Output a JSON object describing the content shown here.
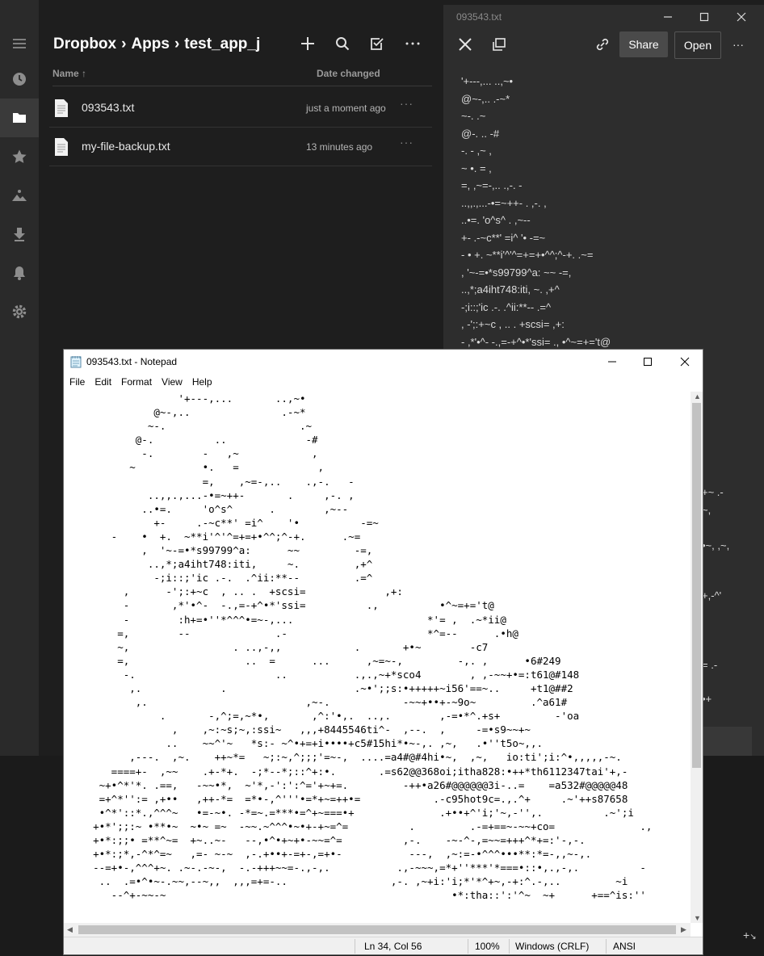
{
  "dropbox": {
    "breadcrumb": [
      "Dropbox",
      "Apps",
      "test_app_j"
    ],
    "breadcrumb_sep": "›",
    "columns": {
      "name": "Name ↑",
      "date": "Date changed"
    },
    "files": [
      {
        "name": "093543.txt",
        "date": "just a moment ago",
        "more": "···"
      },
      {
        "name": "my-file-backup.txt",
        "date": "13 minutes ago",
        "more": "···"
      }
    ]
  },
  "preview": {
    "title": "093543.txt",
    "share_label": "Share",
    "open_label": "Open",
    "more_label": "···",
    "text": "'+---,... ..,~•\n@~-,.. .-~*\n~-. .~\n@-. .. -#\n-. - ,~ ,\n~ •. = ,\n=, ,~=-,.. .,-. -\n..,,.,...-•=~++- . ,-. ,\n..•=. 'o^s^ . ,~--\n+- .-~c**' =i^ '• -=~\n- • +. ~**i'^'^=+=+•^^;^-+. .~=\n, '~-=•*s99799^a: ~~ -=,\n..,*;a4iht748:iti, ~. ,+^\n-;i::;'ic .-. .^ii:**-- .=^\n, -';:+~c , .. . +scsi= ,+:\n- ,*'•^- -.,=-+^•*'ssi= ., •^~=+='t@",
    "peek": [
      "+~ .-",
      "~,",
      "•~, ,~,",
      "+,-^'",
      "= .-",
      "•+"
    ]
  },
  "notepad": {
    "title": "093543.txt - Notepad",
    "menu": [
      "File",
      "Edit",
      "Format",
      "View",
      "Help"
    ],
    "text": "                  '+---,...       ..,~•\n              @~-,..               .-~*\n             ~-.                      .~\n           @-.          ..             -#\n            -.        -   ,~            ,\n          ~           •.   =             ,\n                      =,    ,~=-,..    .,-.   -\n             ..,,.,...-•=~++-       .     ,-. ,\n            ..•=.     'o^s^      .        ,~--\n              +-     .-~c**' =i^    '•          -=~\n       -    •  +.  ~**i'^'^=+=+•^^;^-+.      .~=\n            ,  '~-=•*s99799^a:      ~~         -=,\n             ..,*;a4iht748:iti,     ~.         ,+^\n              -;i::;'ic .-.  .^ii:**--         .=^\n         ,      -';:+~c  , .. .  +scsi=             ,+:\n         -       ,*'•^-  -.,=-+^•*'ssi=          .,          •^~=+='t@\n         -        :h+=•''*^^^•=~-,...                      *'= ,  .~*ii@\n        =,        --              .-                       *^=--      .•h@\n        ~,                 . ..,-,,            .       +•~        -c7\n        =,                   ..  =      ...      ,~=~-,         -,. ,      •6#249\n         -.                       ..           .,.,~+*sco4        , ,-~~+•=:t61@#148\n          ,.             .                     .~•';;s:•+++++~i56'==~..     +t1@##2\n           ,.                          ,~-.            -~~+••+-~9o~         .^a61#\n               .       -,^;=,~*•,       ,^:'•,.  ..,.        ,-=•*^.+s+         -'oa\n                 ,    ,~:~s;~,:ssi~   ,,,+8445546ti^-  ,--.  ,     -=•s9~~+~\n                ..    ~~^'~   *s:- ~^•+=+i••••+c5#15hi*•~-,. ,~,   .•''t5o~,,.\n          ,---.  ,~.    ++~*=   ~;:~,^;;;'=~-,  ....=a4#@#4hi•~,  ,~,   io:ti';i:^•,,,,,-~.\n       ====+-  ,~~    .+-*+.  -;*--*;::^+:•.       .=s62@@368oi;itha828:•++*th6112347tai'+,-\n     ~+•^*'*. .==,   -~~•*,  ~'*,-':':^='+~+=.         -++•a26#@@@@@@3i-..=    =a532#@@@@@48\n     =+^*'':= ,+••   ,++-*=  =*•-,^'''•=*+~=++•=            .-c95hot9c=.,.^+     .~'++s87658\n     •^*'::*.,^^^~   •=-~•. -*=~.=***•=^+~===•+              .+••+^'i;'~,-'',.          .~';i\n    +•*';;:~ •**•~  ~•~ =~  -~~.~^^^•~•+-+~=^=          .         .-=+==~-~~+co=              .,\n    +•*:;;• =**^~=  +~..~-   --,•^•+~+•-~~=^=          ,-.    -~-^-,=~~=+++^*+=:'-,-.\n    +•*:;*,-^*^=~   ,=- ~-~  ,-.+••+-=+-,=+•-           ---,  ,~:=-•^^^•••**:*=-,,~-,.\n    --=+•-,^^^+~. .~-.-~-,  -.-+++~~=-.,-,.           .,-~~~,=*+''***'*===•::•,.,-,.          -\n     ..  .=•^•~-.~~,--~,,  ,,,=+=-..                 ,-. ,~+i:'i;*'*^+~,-+:^.-,..         ~i\n       --^+-~~-~                                               •*:tha::':'^~  ~+      +==^is:''",
    "status": {
      "position": "Ln 34, Col 56",
      "zoom": "100%",
      "eol": "Windows (CRLF)",
      "encoding": "ANSI"
    }
  },
  "colors": {
    "dropbox_bg": "#1e1e1e",
    "rail_bg": "#2a2a2a",
    "preview_bg": "#2d2d2d",
    "notepad_bg": "#ffffff"
  }
}
